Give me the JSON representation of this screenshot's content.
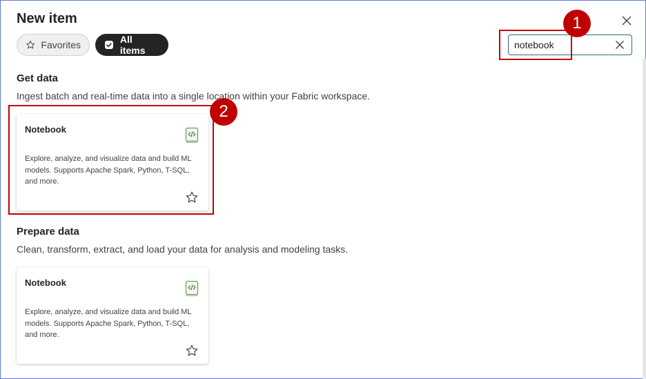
{
  "dialog": {
    "title": "New item"
  },
  "filters": {
    "favorites_label": "Favorites",
    "all_items_label": "All items"
  },
  "search": {
    "value": "notebook",
    "placeholder": ""
  },
  "sections": [
    {
      "title": "Get data",
      "description": "Ingest batch and real-time data into a single location within your Fabric workspace.",
      "cards": [
        {
          "title": "Notebook",
          "description": "Explore, analyze, and visualize data and build ML models. Supports Apache Spark, Python, T-SQL, and more.",
          "icon": "notebook-icon"
        }
      ]
    },
    {
      "title": "Prepare data",
      "description": "Clean, transform, extract, and load your data for analysis and modeling tasks.",
      "cards": [
        {
          "title": "Notebook",
          "description": "Explore, analyze, and visualize data and build ML models. Supports Apache Spark, Python, T-SQL, and more.",
          "icon": "notebook-icon"
        }
      ]
    }
  ],
  "annotations": {
    "step1": "1",
    "step2": "2"
  },
  "colors": {
    "accent": "#2e6f6a",
    "highlight": "#c00000",
    "pill_dark": "#242424"
  }
}
